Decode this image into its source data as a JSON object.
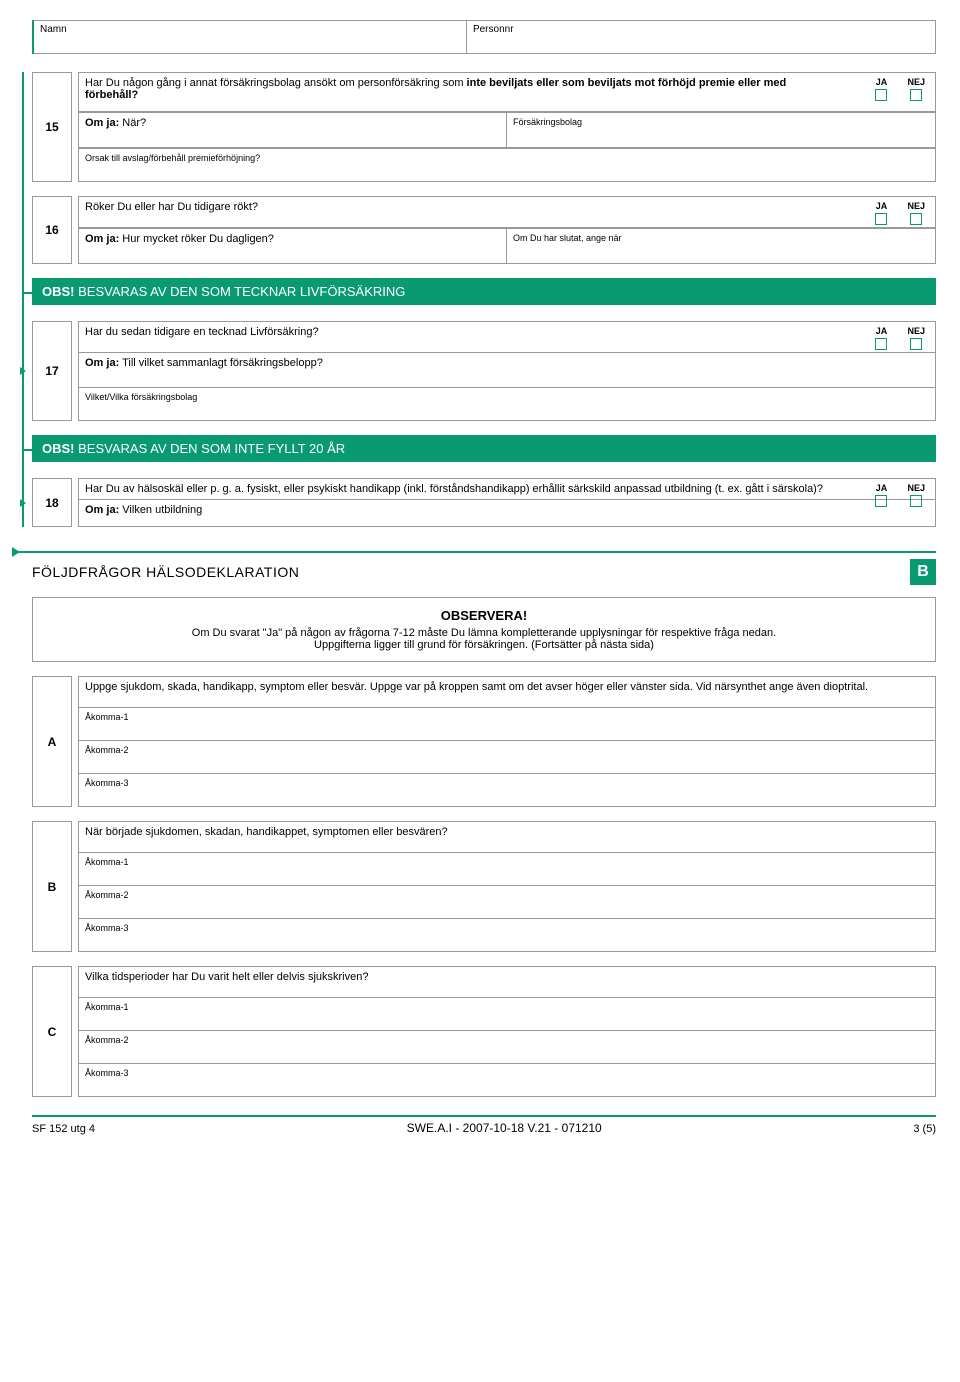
{
  "header": {
    "namn_label": "Namn",
    "personnr_label": "Personnr"
  },
  "yn": {
    "ja": "JA",
    "nej": "NEJ"
  },
  "q15": {
    "num": "15",
    "question_a": "Har Du någon gång i annat försäkringsbolag ansökt om personförsäkring som ",
    "question_b": "inte beviljats eller som beviljats mot förhöjd premie eller med förbehåll?",
    "omja": "Om ja:",
    "nar": " När?",
    "bolag": "Försäkringsbolag",
    "orsak": "Orsak till avslag/förbehåll premieförhöjning?"
  },
  "q16": {
    "num": "16",
    "question": "Röker Du eller har Du tidigare rökt?",
    "omja": "Om ja:",
    "daily": " Hur mycket röker Du dagligen?",
    "slutat": "Om Du har slutat, ange när"
  },
  "band1": {
    "prefix": "OBS! ",
    "text": "BESVARAS AV DEN SOM TECKNAR LIVFÖRSÄKRING"
  },
  "q17": {
    "num": "17",
    "question": "Har du sedan tidigare en tecknad Livförsäkring?",
    "omja": "Om ja:",
    "belopp": " Till vilket sammanlagt försäkringsbelopp?",
    "vilket": "Vilket/Vilka försäkringsbolag"
  },
  "band2": {
    "prefix": "OBS! ",
    "text": "BESVARAS AV DEN SOM INTE FYLLT 20 ÅR"
  },
  "q18": {
    "num": "18",
    "question": "Har Du av hälsoskäl eller p. g. a. fysiskt, eller psykiskt handikapp (inkl. förståndshandikapp) erhållit särkskild anpassad utbildning (t. ex. gått i särskola)?",
    "omja": "Om ja:",
    "utb": " Vilken utbildning"
  },
  "sectionB": {
    "title": "FÖLJDFRÅGOR HÄLSODEKLARATION",
    "badge": "B",
    "obs_title": "OBSERVERA!",
    "obs_line1": "Om Du svarat \"Ja\" på någon av frågorna 7-12 måste Du lämna kompletterande upplysningar för respektive fråga nedan.",
    "obs_line2": "Uppgifterna ligger till grund för försäkringen. (Fortsätter på nästa sida)"
  },
  "subs": {
    "A": {
      "letter": "A",
      "prompt": "Uppge sjukdom, skada, handikapp, symptom eller besvär. Uppge var på kroppen samt om det avser höger eller vänster sida. Vid närsynthet ange även dioptrital."
    },
    "B": {
      "letter": "B",
      "prompt": "När började sjukdomen, skadan, handikappet, symptomen eller besvären?"
    },
    "C": {
      "letter": "C",
      "prompt": "Vilka tidsperioder har Du varit helt eller delvis sjukskriven?"
    },
    "ak1": "Åkomma-1",
    "ak2": "Åkomma-2",
    "ak3": "Åkomma-3"
  },
  "footer": {
    "left": "SF 152  utg 4",
    "mid": "SWE.A.I  -  2007-10-18   V.21 - 071210",
    "right": "3 (5)"
  }
}
